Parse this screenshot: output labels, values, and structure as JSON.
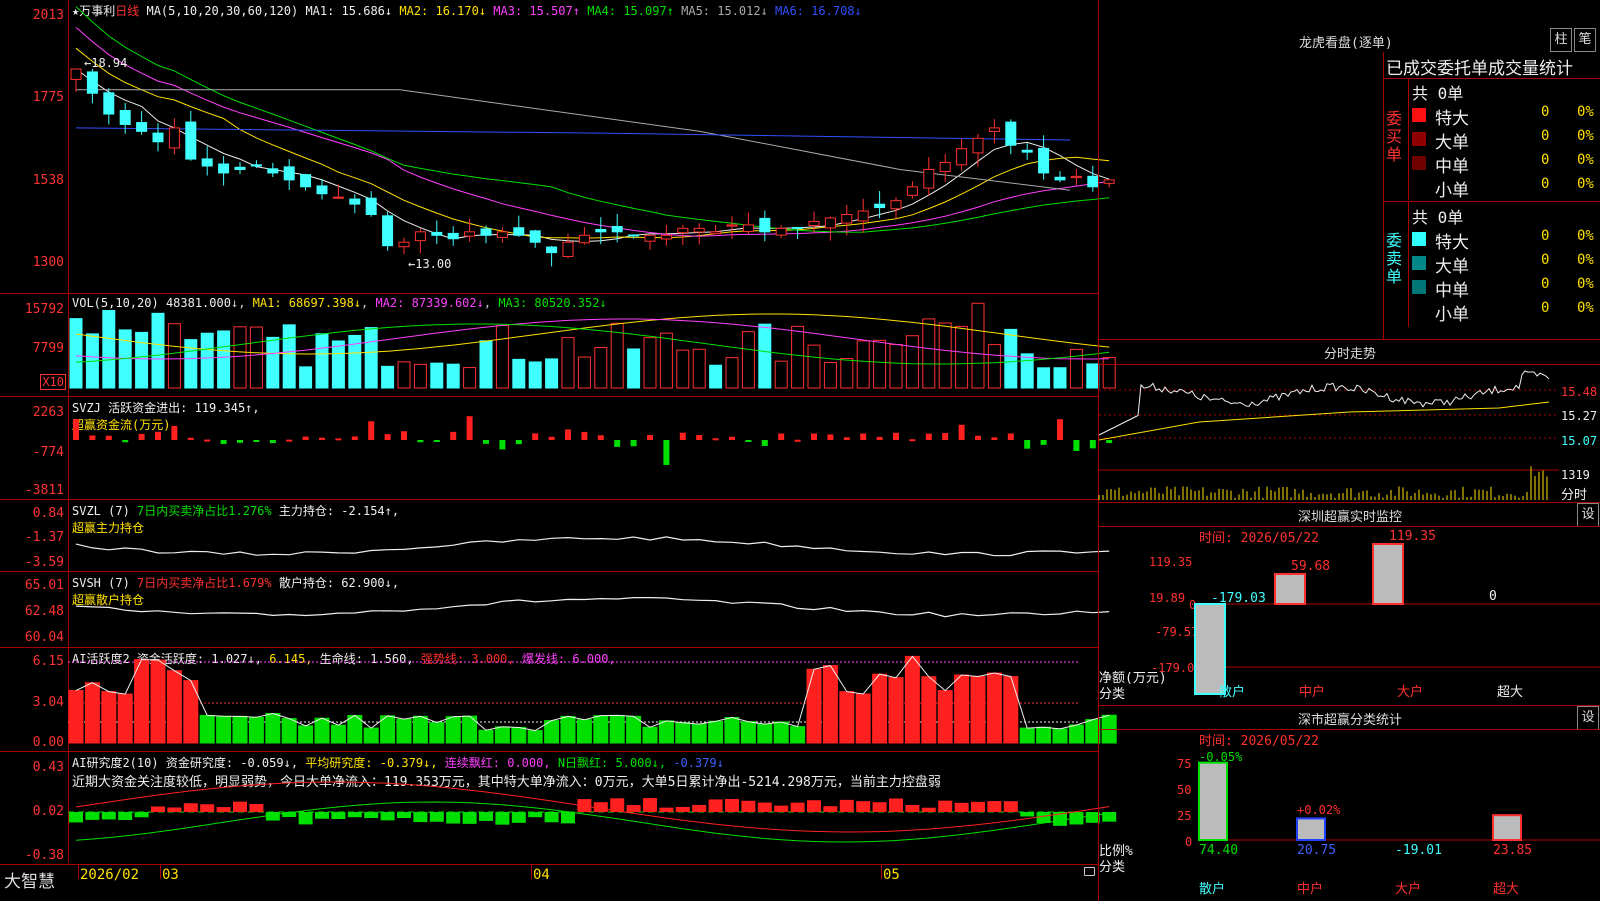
{
  "stock": {
    "name": "★万事利",
    "period": "日线"
  },
  "kline": {
    "ma_title": "MA(5,10,20,30,60,120)",
    "ma": [
      {
        "label": "MA1:",
        "value": "15.686",
        "arrow": "↓",
        "color": "#eeeeee"
      },
      {
        "label": "MA2:",
        "value": "16.170",
        "arrow": "↓",
        "color": "#ffe000"
      },
      {
        "label": "MA3:",
        "value": "15.507",
        "arrow": "↑",
        "color": "#ff40ff"
      },
      {
        "label": "MA4:",
        "value": "15.097",
        "arrow": "↑",
        "color": "#00e000"
      },
      {
        "label": "MA5:",
        "value": "15.012",
        "arrow": "↓",
        "color": "#aaaaaa"
      },
      {
        "label": "MA6:",
        "value": "16.708",
        "arrow": "↓",
        "color": "#3050ff"
      }
    ],
    "y_ticks": [
      "2013",
      "1775",
      "1538",
      "1300"
    ],
    "high_label": "18.94",
    "low_label": "13.00"
  },
  "vol": {
    "title": "VOL(5,10,20)",
    "value": "48381.000",
    "ma1": "MA1: 68697.398↓",
    "ma2": "MA2: 87339.602↓",
    "ma3": "MA3: 80520.352↓",
    "y_ticks": [
      "15792",
      "7799"
    ],
    "unit": "X10"
  },
  "svzj": {
    "title": "SVZJ",
    "label": "活跃资金进出: 119.345↑,",
    "subtitle": "超赢资金流(万元)",
    "y_ticks": [
      "2263",
      "-774",
      "-3811"
    ]
  },
  "svzl": {
    "title": "SVZL (7)",
    "ratio": "7日内买卖净占比1.276%",
    "hold": "主力持仓: -2.154↑,",
    "subtitle": "超赢主力持仓",
    "y_ticks": [
      "0.84",
      "-1.37",
      "-3.59"
    ]
  },
  "svsh": {
    "title": "SVSH (7)",
    "ratio": "7日内买卖净占比1.679%",
    "hold": "散户持仓: 62.900↓,",
    "subtitle": "超赢散户持仓",
    "y_ticks": [
      "65.01",
      "62.48",
      "60.04"
    ]
  },
  "ai_active": {
    "title": "AI活跃度2",
    "fund": "资金活跃度: 1.027↓,",
    "val2": "6.145,",
    "life": "生命线: 1.560,",
    "strong": "强势线: 3.000,",
    "burst": "爆发线: 6.000,",
    "y_ticks": [
      "6.15",
      "3.04",
      "0.00"
    ]
  },
  "ai_research": {
    "title": "AI研究度2(10)",
    "fund": "资金研究度: -0.059↓,",
    "avg": "平均研究度: -0.379↓,",
    "red": "连续飘红: 0.000,",
    "nred": "N日飘红: 5.000↓,",
    "last": "-0.379↓",
    "comment": "近期大资金关注度较低，明显弱势，今日大单净流入：119.353万元，其中特大单净流入：0万元，大单5日累计净出-5214.298万元，当前主力控盘弱",
    "y_ticks": [
      "0.43",
      "0.02",
      "-0.38"
    ]
  },
  "footer": {
    "brand": "大智慧",
    "dates": [
      "2026/02",
      "03",
      "04",
      "05"
    ]
  },
  "dragon": {
    "title": "龙虎看盘(逐单)",
    "btn_bar": "柱",
    "btn_pen": "笔",
    "subheader": "已成交委托单成交量统计",
    "buy_label": "委买单",
    "sell_label": "委卖单",
    "buy_total": "共 0单",
    "sell_total": "共 0单",
    "buy_rows": [
      {
        "name": "特大",
        "count": "0",
        "pct": "0%",
        "color": "#ff1010"
      },
      {
        "name": "大单",
        "count": "0",
        "pct": "0%",
        "color": "#900000"
      },
      {
        "name": "中单",
        "count": "0",
        "pct": "0%",
        "color": "#700000"
      },
      {
        "name": "小单",
        "count": "0",
        "pct": "0%",
        "color": "#000000"
      }
    ],
    "sell_rows": [
      {
        "name": "特大",
        "count": "0",
        "pct": "0%",
        "color": "#30ffff"
      },
      {
        "name": "大单",
        "count": "0",
        "pct": "0%",
        "color": "#008888"
      },
      {
        "name": "中单",
        "count": "0",
        "pct": "0%",
        "color": "#007777"
      },
      {
        "name": "小单",
        "count": "0",
        "pct": "0%",
        "color": "#000000"
      }
    ]
  },
  "intraday": {
    "title": "分时走势",
    "prices": [
      "15.48",
      "15.27",
      "15.07"
    ],
    "vol_label": "1319",
    "vol_unit": "分时"
  },
  "monitor": {
    "title": "深圳超赢实时监控",
    "btn": "设",
    "time": "时间: 2026/05/22",
    "y_ticks": [
      "119.35",
      "19.89",
      "0",
      "-79.57",
      "-179.03"
    ],
    "axis_title": "净额(万元)",
    "axis_sub": "分类",
    "categories": [
      "散户",
      "中户",
      "大户",
      "超大"
    ],
    "values": [
      -179.03,
      59.68,
      119.35,
      0
    ],
    "value_labels": [
      "-179.03",
      "59.68",
      "119.35",
      "0"
    ]
  },
  "classify": {
    "title": "深市超赢分类统计",
    "btn": "设",
    "time": "时间: 2026/05/22",
    "y_ticks": [
      "75",
      "50",
      "25",
      "0"
    ],
    "axis_title": "比例%",
    "axis_sub": "分类",
    "categories": [
      "散户",
      "中户",
      "大户",
      "超大"
    ],
    "values": [
      74.4,
      20.75,
      -19.01,
      23.85
    ],
    "value_labels": [
      "74.40",
      "20.75",
      "-19.01",
      "23.85"
    ],
    "change_labels": [
      "-0.05%",
      "+0.02%"
    ]
  },
  "chart_data": {
    "type": "bar",
    "title": "深市超赢分类统计",
    "categories": [
      "散户",
      "中户",
      "大户",
      "超大"
    ],
    "values": [
      74.4,
      20.75,
      -19.01,
      23.85
    ],
    "ylabel": "比例%",
    "ylim": [
      0,
      75
    ]
  }
}
